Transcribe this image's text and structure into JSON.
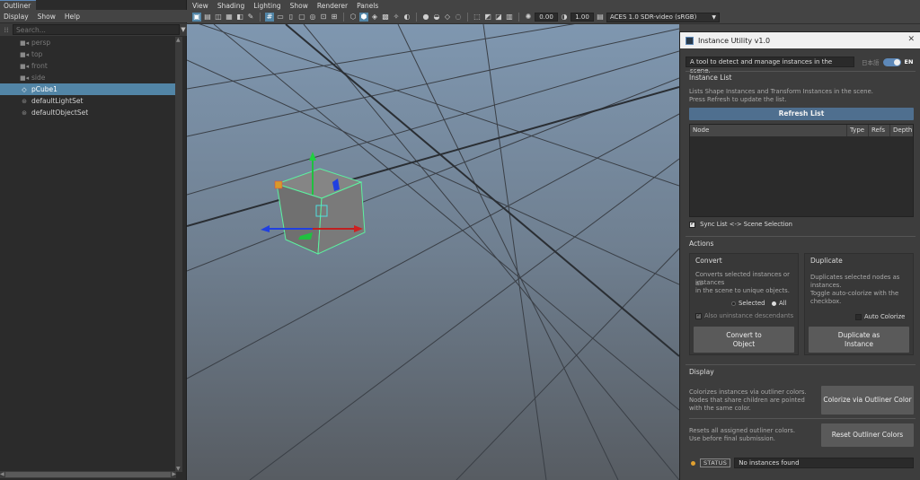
{
  "outliner": {
    "tab": "Outliner",
    "menu": [
      "Display",
      "Show",
      "Help"
    ],
    "search_placeholder": "Search...",
    "items": [
      {
        "label": "persp",
        "icon": "camera-icon"
      },
      {
        "label": "top",
        "icon": "camera-icon"
      },
      {
        "label": "front",
        "icon": "camera-icon"
      },
      {
        "label": "side",
        "icon": "camera-icon"
      },
      {
        "label": "pCube1",
        "icon": "mesh-icon"
      },
      {
        "label": "defaultLightSet",
        "icon": "set-icon"
      },
      {
        "label": "defaultObjectSet",
        "icon": "set-icon"
      }
    ]
  },
  "viewport": {
    "menu": [
      "View",
      "Shading",
      "Lighting",
      "Show",
      "Renderer",
      "Panels"
    ],
    "exposure": "0.00",
    "gamma": "1.00",
    "color_space": "ACES 1.0 SDR-video (sRGB)"
  },
  "tool": {
    "title": "Instance Utility v1.0",
    "description": "A tool to detect and manage instances in the scene.",
    "lang_ja": "日本語",
    "lang_en": "EN",
    "instance_list": {
      "title": "Instance List",
      "help_line1": "Lists Shape Instances and Transform Instances in the scene.",
      "help_line2": "Press Refresh to update the list.",
      "refresh_label": "Refresh List",
      "columns": [
        "Node",
        "Type",
        "Refs",
        "Depth"
      ],
      "sync_label": "Sync List <-> Scene Selection"
    },
    "actions": {
      "title": "Actions",
      "convert": {
        "title": "Convert",
        "help_line1": "Converts selected instances or all",
        "help_line2": "instances",
        "help_line3": "in the scene to unique objects.",
        "opt_selected": "Selected",
        "opt_all": "All",
        "also_label": "Also uninstance descendants",
        "button_line1": "Convert to",
        "button_line2": "Object"
      },
      "duplicate": {
        "title": "Duplicate",
        "help_line1": "Duplicates selected nodes as",
        "help_line2": "instances.",
        "help_line3": "Toggle auto-colorize with the",
        "help_line4": "checkbox.",
        "auto_label": "Auto Colorize",
        "button_line1": "Duplicate as",
        "button_line2": "Instance"
      }
    },
    "display": {
      "title": "Display",
      "colorize_help1": "Colorizes instances via outliner colors.",
      "colorize_help2": "Nodes that share children are pointed",
      "colorize_help3": "with the same color.",
      "colorize_button": "Colorize via Outliner Color",
      "reset_help1": "Resets all assigned outliner colors.",
      "reset_help2": "Use before final submission.",
      "reset_button": "Reset Outliner Colors"
    },
    "status": {
      "tag": "STATUS",
      "text": "No instances found"
    }
  }
}
